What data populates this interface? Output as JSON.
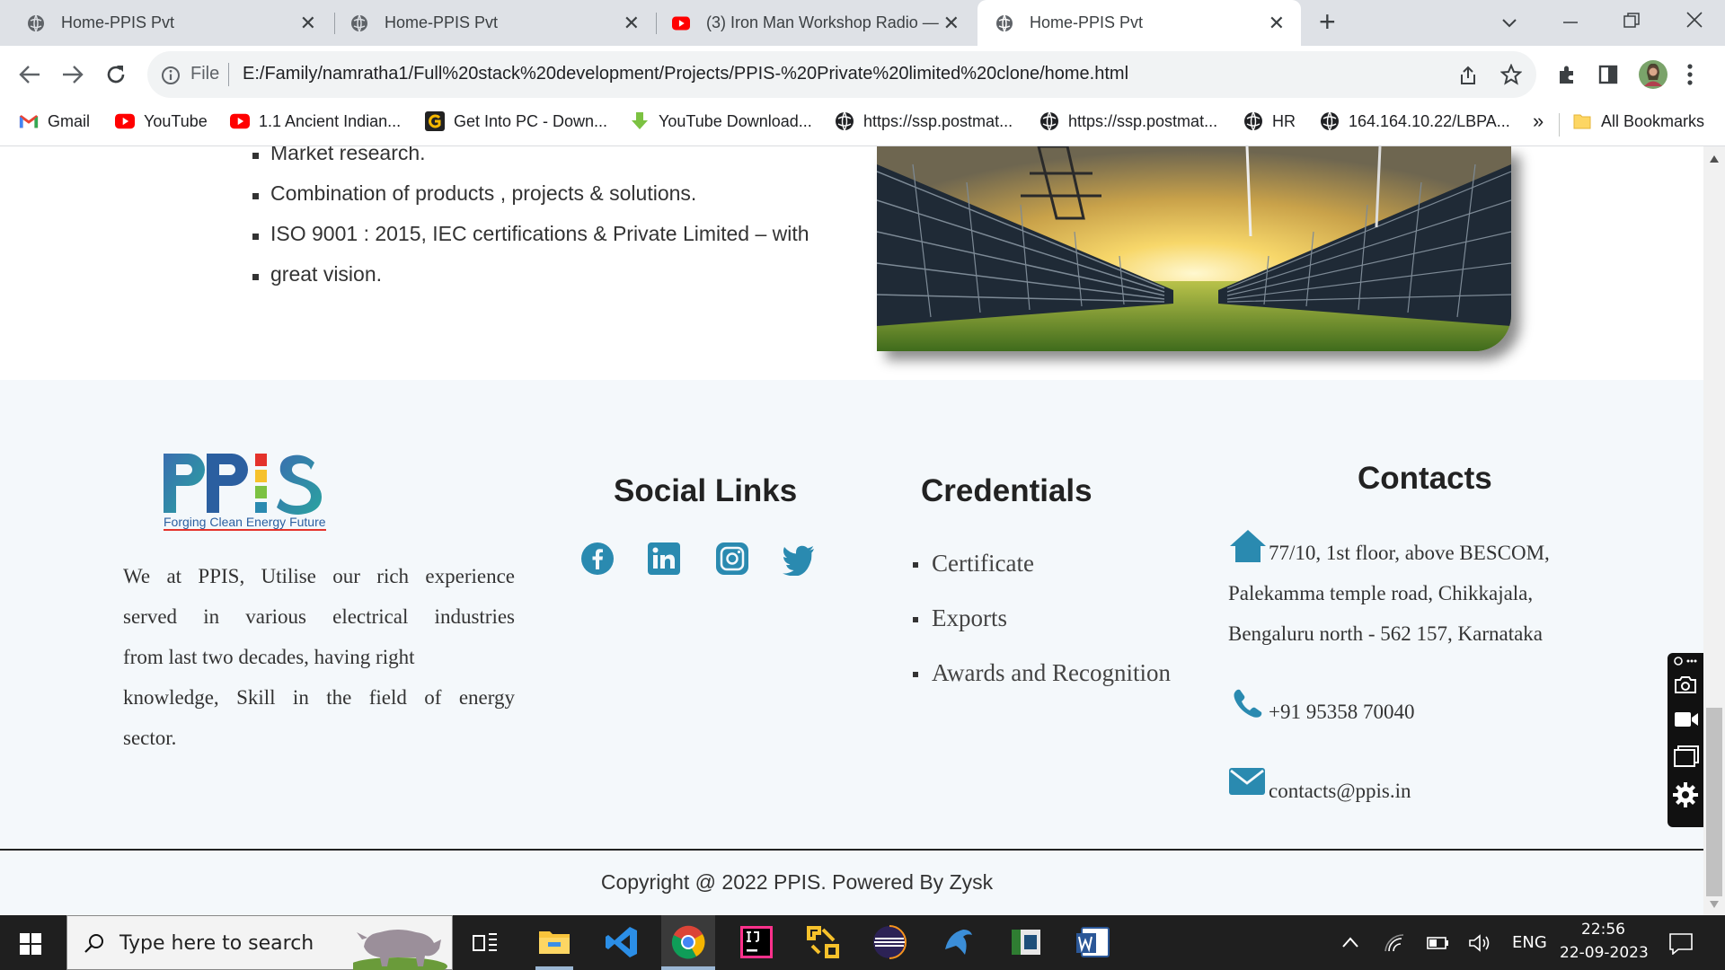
{
  "browser": {
    "tabs": [
      {
        "title": "Home-PPIS Pvt",
        "icon": "globe-icon",
        "active": false
      },
      {
        "title": "Home-PPIS Pvt",
        "icon": "globe-icon",
        "active": false
      },
      {
        "title": "(3) Iron Man Workshop Radio —",
        "icon": "youtube-icon",
        "active": false
      },
      {
        "title": "Home-PPIS Pvt",
        "icon": "globe-icon",
        "active": true
      }
    ],
    "new_tab_glyph": "+",
    "address": {
      "scheme_label": "File",
      "url": "E:/Family/namratha1/Full%20stack%20development/Projects/PPIS-%20Private%20limited%20clone/home.html"
    },
    "bookmarks": [
      {
        "label": "Gmail",
        "icon": "gmail-icon"
      },
      {
        "label": "YouTube",
        "icon": "youtube-icon"
      },
      {
        "label": "1.1 Ancient Indian...",
        "icon": "youtube-icon"
      },
      {
        "label": "Get Into PC - Down...",
        "icon": "getintopc-icon"
      },
      {
        "label": "YouTube Download...",
        "icon": "download-icon"
      },
      {
        "label": "https://ssp.postmat...",
        "icon": "globe-icon"
      },
      {
        "label": "https://ssp.postmat...",
        "icon": "globe-icon"
      },
      {
        "label": "HR",
        "icon": "globe-icon"
      },
      {
        "label": "164.164.10.22/LBPA...",
        "icon": "globe-icon"
      }
    ],
    "bookmarks_overflow": "»",
    "all_bookmarks": "All Bookmarks"
  },
  "page": {
    "bullets": [
      "Market research.",
      "Combination of products , projects & solutions.",
      "ISO 9001 : 2015, IEC certifications & Private Limited – with",
      "great vision."
    ],
    "footer": {
      "logo": {
        "text": "PPIS",
        "tagline": "Forging Clean Energy Future"
      },
      "about": [
        "We at PPIS, Utilise our rich experience",
        "served in various electrical industries",
        "from last two decades, having right",
        "knowledge, Skill in the field of energy",
        "sector."
      ],
      "social": {
        "heading": "Social Links",
        "icons": [
          "facebook-icon",
          "linkedin-icon",
          "instagram-icon",
          "twitter-icon"
        ]
      },
      "credentials": {
        "heading": "Credentials",
        "items": [
          "Certificate",
          "Exports",
          "Awards and Recognition"
        ]
      },
      "contacts": {
        "heading": "Contacts",
        "address_lines": [
          "77/10, 1st floor, above BESCOM,",
          "Palekamma temple road, Chikkajala,",
          "Bengaluru north - 562 157, Karnataka"
        ],
        "phone": "+91 95358 70040",
        "email": "contacts@ppis.in"
      },
      "copyright": "Copyright @ 2022 PPIS. Powered By Zysk"
    }
  },
  "taskbar": {
    "search_placeholder": "Type here to search",
    "lang": "ENG",
    "time": "22:56",
    "date": "22-09-2023"
  },
  "colors": {
    "accent": "#2a8ab0",
    "footer_bg": "#f4f8fb",
    "tabstrip_bg": "#dee1e6"
  }
}
